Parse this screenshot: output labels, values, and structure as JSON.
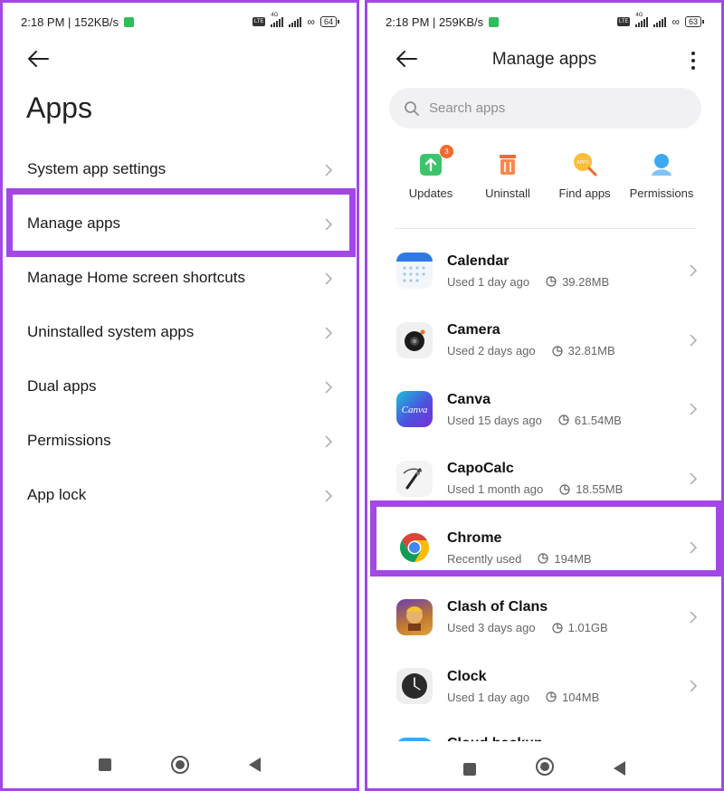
{
  "left": {
    "status": {
      "time": "2:18 PM | 152KB/s",
      "battery": "64",
      "network": "4G"
    },
    "title": "Apps",
    "menu": [
      {
        "label": "System app settings"
      },
      {
        "label": "Manage apps"
      },
      {
        "label": "Manage Home screen shortcuts"
      },
      {
        "label": "Uninstalled system apps"
      },
      {
        "label": "Dual apps"
      },
      {
        "label": "Permissions"
      },
      {
        "label": "App lock"
      }
    ]
  },
  "right": {
    "status": {
      "time": "2:18 PM | 259KB/s",
      "battery": "63",
      "network": "4G"
    },
    "title": "Manage apps",
    "search": {
      "placeholder": "Search apps"
    },
    "quick_actions": [
      {
        "label": "Updates",
        "icon": "updates-icon",
        "badge": "3"
      },
      {
        "label": "Uninstall",
        "icon": "trash-icon"
      },
      {
        "label": "Find apps",
        "icon": "find-apps-icon",
        "icon_text": "APPS"
      },
      {
        "label": "Permissions",
        "icon": "permissions-icon"
      }
    ],
    "apps": [
      {
        "name": "Calendar",
        "used": "Used 1 day ago",
        "size": "39.28MB"
      },
      {
        "name": "Camera",
        "used": "Used 2 days ago",
        "size": "32.81MB"
      },
      {
        "name": "Canva",
        "used": "Used 15 days ago",
        "size": "61.54MB",
        "icon_text": "Canva"
      },
      {
        "name": "CapoCalc",
        "used": "Used 1 month ago",
        "size": "18.55MB"
      },
      {
        "name": "Chrome",
        "used": "Recently used",
        "size": "194MB"
      },
      {
        "name": "Clash of Clans",
        "used": "Used 3 days ago",
        "size": "1.01GB"
      },
      {
        "name": "Clock",
        "used": "Used 1 day ago",
        "size": "104MB"
      },
      {
        "name": "Cloud backup",
        "used": "",
        "size": ""
      }
    ]
  },
  "colors": {
    "highlight": "#a347e6",
    "accent_orange": "#f36a2c",
    "updates_green": "#3cc46b",
    "permissions_blue": "#3fa8f2"
  }
}
